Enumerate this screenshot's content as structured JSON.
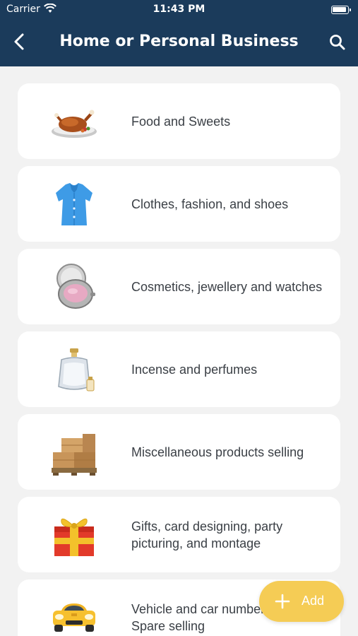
{
  "status_bar": {
    "carrier": "Carrier",
    "time": "11:43 PM"
  },
  "header": {
    "title": "Home or Personal Business"
  },
  "categories": [
    {
      "label": "Food and Sweets",
      "icon": "roast-chicken-icon"
    },
    {
      "label": "Clothes, fashion, and shoes",
      "icon": "shirt-icon"
    },
    {
      "label": "Cosmetics, jewellery and watches",
      "icon": "compact-powder-icon"
    },
    {
      "label": "Incense and perfumes",
      "icon": "perfume-icon"
    },
    {
      "label": "Miscellaneous products selling",
      "icon": "boxes-pallet-icon"
    },
    {
      "label": "Gifts, card designing, party picturing, and montage",
      "icon": "gift-box-icon"
    },
    {
      "label": "Vehicle and car numbers and Spare selling",
      "icon": "car-icon"
    }
  ],
  "fab": {
    "label": "Add"
  },
  "colors": {
    "header": "#1b3b5b",
    "background": "#f2f2f2",
    "accent": "#f5cc55"
  }
}
